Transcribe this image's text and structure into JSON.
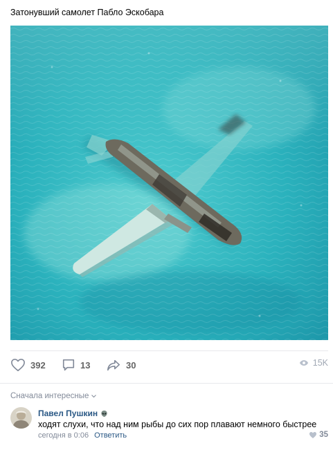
{
  "post": {
    "title": "Затонувший самолет Пабло Эскобара",
    "image_icon": "sunken-airplane-photo"
  },
  "actions": {
    "likes": "392",
    "comments": "13",
    "shares": "30",
    "views": "15K",
    "like_icon": "heart-icon",
    "comment_icon": "comment-icon",
    "share_icon": "share-arrow-icon",
    "views_icon": "eye-icon"
  },
  "comments_section": {
    "sort_label": "Сначала интересные",
    "items": [
      {
        "author": "Павел Пушкин",
        "badge_icon": "alien-icon",
        "text": "ходят слухи, что над ним рыбы до сих пор плавают немного быстрее",
        "time": "сегодня в 0:06",
        "reply_label": "Ответить",
        "likes": "35"
      }
    ]
  },
  "colors": {
    "link": "#2a5885",
    "muted": "#828a99",
    "water": "#2fb3bd"
  }
}
